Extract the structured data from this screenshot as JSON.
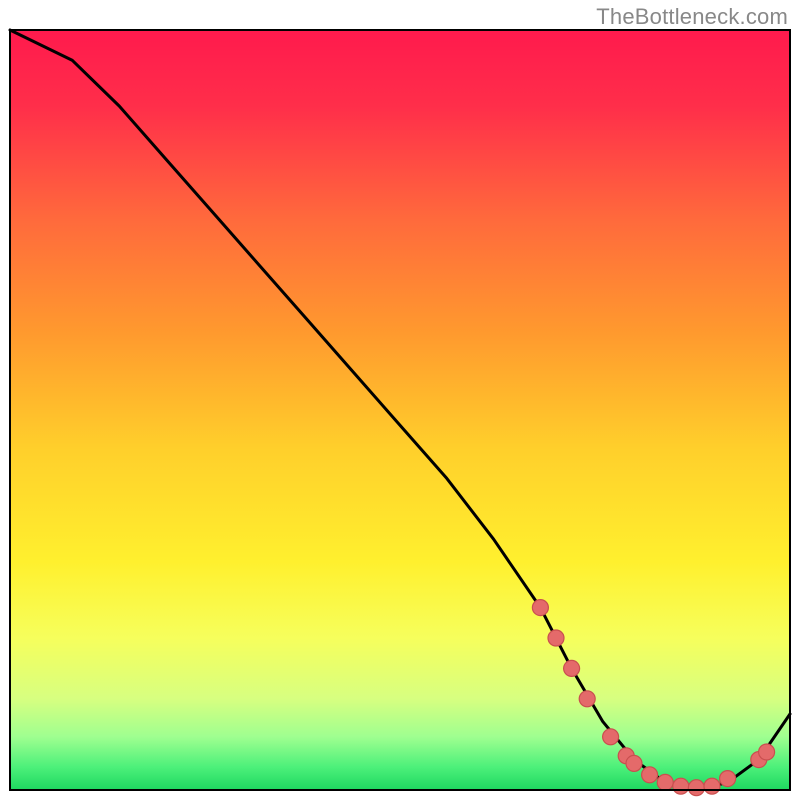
{
  "attribution": "TheBottleneck.com",
  "chart_data": {
    "type": "line",
    "title": "",
    "xlabel": "",
    "ylabel": "",
    "xlim": [
      0,
      100
    ],
    "ylim": [
      0,
      100
    ],
    "x": [
      0,
      8,
      14,
      20,
      26,
      32,
      38,
      44,
      50,
      56,
      62,
      68,
      72,
      76,
      80,
      84,
      88,
      92,
      96,
      100
    ],
    "y": [
      100,
      96,
      90,
      83,
      76,
      69,
      62,
      55,
      48,
      41,
      33,
      24,
      16,
      9,
      4,
      1,
      0,
      1,
      4,
      10
    ],
    "series_name": "bottleneck-curve",
    "markers": [
      {
        "x": 68,
        "y": 24
      },
      {
        "x": 70,
        "y": 20
      },
      {
        "x": 72,
        "y": 16
      },
      {
        "x": 74,
        "y": 12
      },
      {
        "x": 77,
        "y": 7
      },
      {
        "x": 79,
        "y": 4.5
      },
      {
        "x": 80,
        "y": 3.5
      },
      {
        "x": 82,
        "y": 2
      },
      {
        "x": 84,
        "y": 1
      },
      {
        "x": 86,
        "y": 0.5
      },
      {
        "x": 88,
        "y": 0.3
      },
      {
        "x": 90,
        "y": 0.5
      },
      {
        "x": 92,
        "y": 1.5
      },
      {
        "x": 96,
        "y": 4
      },
      {
        "x": 97,
        "y": 5
      }
    ],
    "gradient_stops": [
      {
        "offset": 0.0,
        "color": "#ff1a4d"
      },
      {
        "offset": 0.1,
        "color": "#ff2e4a"
      },
      {
        "offset": 0.25,
        "color": "#ff6a3c"
      },
      {
        "offset": 0.4,
        "color": "#ff9a2e"
      },
      {
        "offset": 0.55,
        "color": "#ffcf2b"
      },
      {
        "offset": 0.7,
        "color": "#fff02e"
      },
      {
        "offset": 0.8,
        "color": "#f6ff5c"
      },
      {
        "offset": 0.88,
        "color": "#d7ff80"
      },
      {
        "offset": 0.93,
        "color": "#9fff90"
      },
      {
        "offset": 0.97,
        "color": "#4cf07a"
      },
      {
        "offset": 1.0,
        "color": "#1ed760"
      }
    ],
    "colors": {
      "line": "#000000",
      "marker_fill": "#e46a6a",
      "marker_stroke": "#c94f4f",
      "border": "#000000"
    }
  }
}
